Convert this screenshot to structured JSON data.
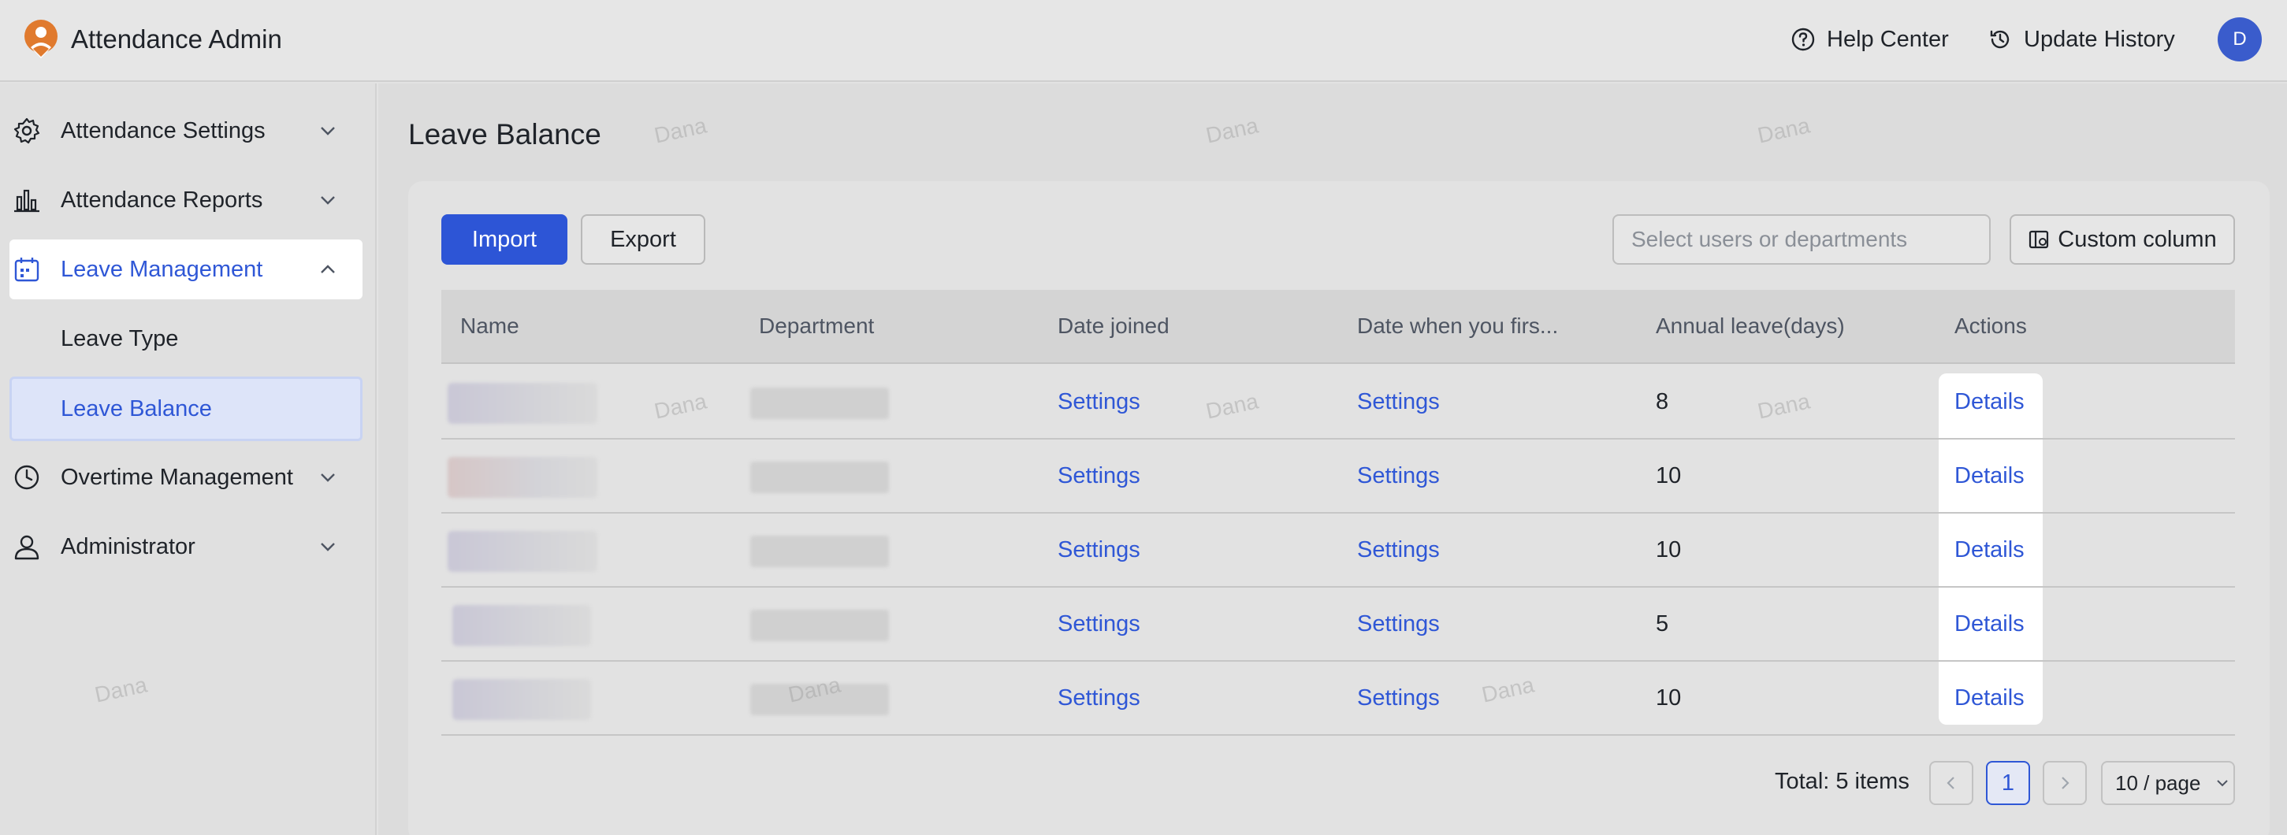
{
  "header": {
    "app_title": "Attendance Admin",
    "help_center": "Help Center",
    "update_history": "Update History",
    "avatar_initial": "D"
  },
  "sidebar": {
    "items": [
      {
        "label": "Attendance Settings",
        "icon": "gear-icon"
      },
      {
        "label": "Attendance Reports",
        "icon": "bar-chart-icon"
      },
      {
        "label": "Leave Management",
        "icon": "calendar-icon"
      },
      {
        "label": "Leave Type"
      },
      {
        "label": "Leave Balance"
      },
      {
        "label": "Overtime Management",
        "icon": "clock-icon"
      },
      {
        "label": "Administrator",
        "icon": "user-icon"
      }
    ]
  },
  "page": {
    "title": "Leave Balance"
  },
  "toolbar": {
    "import_label": "Import",
    "export_label": "Export",
    "search_placeholder": "Select users or departments",
    "custom_column_label": "Custom column"
  },
  "table": {
    "columns": [
      "Name",
      "Department",
      "Date joined",
      "Date when you firs...",
      "Annual leave(days)",
      "Actions"
    ],
    "rows": [
      {
        "date_joined": "Settings",
        "date_first": "Settings",
        "annual_leave": "8",
        "action": "Details"
      },
      {
        "date_joined": "Settings",
        "date_first": "Settings",
        "annual_leave": "10",
        "action": "Details"
      },
      {
        "date_joined": "Settings",
        "date_first": "Settings",
        "annual_leave": "10",
        "action": "Details"
      },
      {
        "date_joined": "Settings",
        "date_first": "Settings",
        "annual_leave": "5",
        "action": "Details"
      },
      {
        "date_joined": "Settings",
        "date_first": "Settings",
        "annual_leave": "10",
        "action": "Details"
      }
    ]
  },
  "pagination": {
    "total": "Total: 5 items",
    "current_page": "1",
    "page_size": "10 / page"
  },
  "watermark_text": "Dana",
  "colors": {
    "accent": "#2d55d6",
    "link": "#2f57d6",
    "logo": "#e07a2e"
  }
}
